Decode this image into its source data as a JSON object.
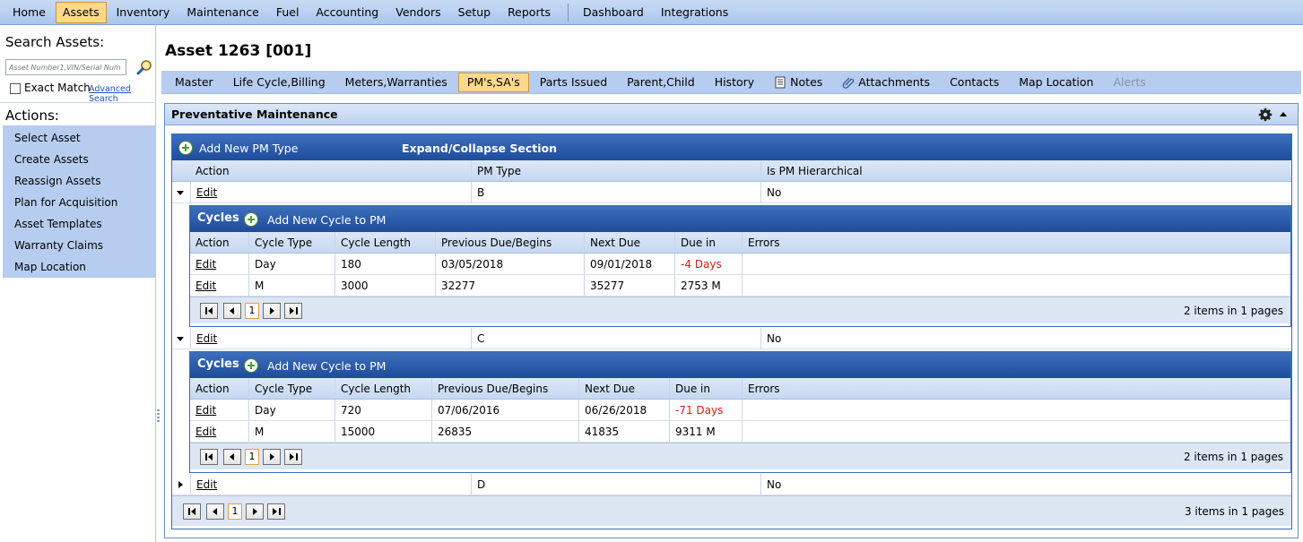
{
  "menu": {
    "items": [
      "Home",
      "Assets",
      "Inventory",
      "Maintenance",
      "Fuel",
      "Accounting",
      "Vendors",
      "Setup",
      "Reports"
    ],
    "items2": [
      "Dashboard",
      "Integrations"
    ],
    "active": "Assets"
  },
  "left": {
    "search_title": "Search Assets:",
    "search_placeholder": "Asset Number1,VIN/Serial Num",
    "exact_match_label": "Exact Match",
    "advanced_search_label": "Advanced Search",
    "actions_title": "Actions:",
    "actions": [
      "Select Asset",
      "Create Assets",
      "Reassign Assets",
      "Plan for Acquisition",
      "Asset Templates",
      "Warranty Claims",
      "Map Location"
    ]
  },
  "page": {
    "title": "Asset 1263 [001]"
  },
  "tabs": {
    "items": [
      "Master",
      "Life Cycle,Billing",
      "Meters,Warranties",
      "PM's,SA's",
      "Parts Issued",
      "Parent,Child",
      "History",
      "Notes",
      "Attachments",
      "Contacts",
      "Map Location",
      "Alerts"
    ],
    "active": "PM's,SA's",
    "disabled": "Alerts"
  },
  "section": {
    "title": "Preventative Maintenance",
    "add_pm_type_label": "Add New PM Type",
    "expand_collapse_label": "Expand/Collapse Section",
    "columns": [
      "Action",
      "PM Type",
      "Is PM Hierarchical"
    ],
    "cycles_title": "Cycles",
    "add_cycle_label": "Add New Cycle to PM",
    "cycle_columns": [
      "Action",
      "Cycle Type",
      "Cycle Length",
      "Previous Due/Begins",
      "Next Due",
      "Due in",
      "Errors"
    ],
    "pm_rows": [
      {
        "action": "Edit",
        "pm_type": "B",
        "hierarchical": "No",
        "cycles": [
          {
            "action": "Edit",
            "cycle_type": "Day",
            "cycle_length": "180",
            "previous_due": "03/05/2018",
            "next_due": "09/01/2018",
            "due_in": "-4 Days",
            "errors": ""
          },
          {
            "action": "Edit",
            "cycle_type": "M",
            "cycle_length": "3000",
            "previous_due": "32277",
            "next_due": "35277",
            "due_in": "2753 M",
            "errors": ""
          }
        ],
        "pager_page": "1",
        "pager_info": "2 items in 1 pages"
      },
      {
        "action": "Edit",
        "pm_type": "C",
        "hierarchical": "No",
        "cycles": [
          {
            "action": "Edit",
            "cycle_type": "Day",
            "cycle_length": "720",
            "previous_due": "07/06/2016",
            "next_due": "06/26/2018",
            "due_in": "-71 Days",
            "errors": ""
          },
          {
            "action": "Edit",
            "cycle_type": "M",
            "cycle_length": "15000",
            "previous_due": "26835",
            "next_due": "41835",
            "due_in": "9311 M",
            "errors": ""
          }
        ],
        "pager_page": "1",
        "pager_info": "2 items in 1 pages"
      },
      {
        "action": "Edit",
        "pm_type": "D",
        "hierarchical": "No"
      }
    ],
    "pager_page": "1",
    "pager_info": "3 items in 1 pages"
  },
  "colors": {
    "accent_active": "#ffd98a",
    "header_blue": "#1e4c9a",
    "overdue_red": "#d21c1c",
    "sidebar_blue": "#b6cdf0"
  }
}
